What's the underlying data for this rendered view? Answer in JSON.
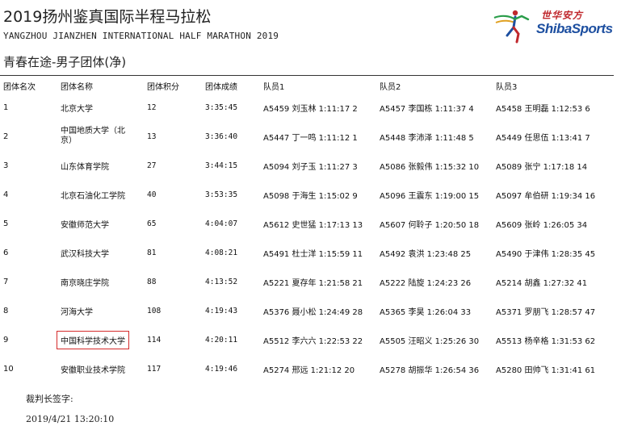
{
  "header": {
    "title_zh": "2019扬州鉴真国际半程马拉松",
    "title_en": "YANGZHOU JIANZHEN INTERNATIONAL HALF MARATHON 2019",
    "subtitle": "青春在途-男子团体(净)"
  },
  "logo": {
    "brand_cn": "世华安方",
    "brand_en": "ShibaSports",
    "icon": "runner-logo-icon",
    "colors": {
      "red": "#c0282d",
      "blue": "#1d4fa0",
      "green": "#2a9d4a"
    }
  },
  "table": {
    "columns": [
      "团体名次",
      "团体名称",
      "团体积分",
      "团体成绩",
      "队员1",
      "队员2",
      "队员3"
    ],
    "rows": [
      {
        "rank": "1",
        "team": "北京大学",
        "points": "12",
        "time": "3:35:45",
        "m1": "A5459  刘玉林  1:11:17  2",
        "m2": "A5457  李国栋  1:11:37  4",
        "m3": "A5458  王明磊  1:12:53  6"
      },
      {
        "rank": "2",
        "team": "中国地质大学（北京）",
        "points": "13",
        "time": "3:36:40",
        "m1": "A5447  丁一鸣  1:11:12  1",
        "m2": "A5448  李沛泽  1:11:48  5",
        "m3": "A5449  任思伍  1:13:41  7"
      },
      {
        "rank": "3",
        "team": "山东体育学院",
        "points": "27",
        "time": "3:44:15",
        "m1": "A5094  刘子玉  1:11:27  3",
        "m2": "A5086  张毅伟  1:15:32  10",
        "m3": "A5089  张宁  1:17:18  14"
      },
      {
        "rank": "4",
        "team": "北京石油化工学院",
        "points": "40",
        "time": "3:53:35",
        "m1": "A5098  于海生  1:15:02  9",
        "m2": "A5096  王震东  1:19:00  15",
        "m3": "A5097  牟伯研  1:19:34  16"
      },
      {
        "rank": "5",
        "team": "安徽师范大学",
        "points": "65",
        "time": "4:04:07",
        "m1": "A5612  史世猛  1:17:13  13",
        "m2": "A5607  何聆子  1:20:50  18",
        "m3": "A5609  张岭  1:26:05  34"
      },
      {
        "rank": "6",
        "team": "武汉科技大学",
        "points": "81",
        "time": "4:08:21",
        "m1": "A5491  杜士洋  1:15:59  11",
        "m2": "A5492  袁洪  1:23:48  25",
        "m3": "A5490  于津伟  1:28:35  45"
      },
      {
        "rank": "7",
        "team": "南京晓庄学院",
        "points": "88",
        "time": "4:13:52",
        "m1": "A5221  夏存年  1:21:58  21",
        "m2": "A5222  陆旋  1:24:23  26",
        "m3": "A5214  胡鑫  1:27:32  41"
      },
      {
        "rank": "8",
        "team": "河海大学",
        "points": "108",
        "time": "4:19:43",
        "m1": "A5376  聂小松  1:24:49  28",
        "m2": "A5365  李昊  1:26:04  33",
        "m3": "A5371  罗朋飞  1:28:57  47"
      },
      {
        "rank": "9",
        "team": "中国科学技术大学",
        "points": "114",
        "time": "4:20:11",
        "m1": "A5512  李六六  1:22:53  22",
        "m2": "A5505  汪昭义  1:25:26  30",
        "m3": "A5513  杨辛格  1:31:53  62"
      },
      {
        "rank": "10",
        "team": "安徽职业技术学院",
        "points": "117",
        "time": "4:19:46",
        "m1": "A5274  邢远  1:21:12  20",
        "m2": "A5278  胡振华  1:26:54  36",
        "m3": "A5280  田帅飞  1:31:41  61"
      }
    ]
  },
  "footer": {
    "judge_label": "裁判长签字:",
    "timestamp": "2019/4/21  13:20:10"
  }
}
